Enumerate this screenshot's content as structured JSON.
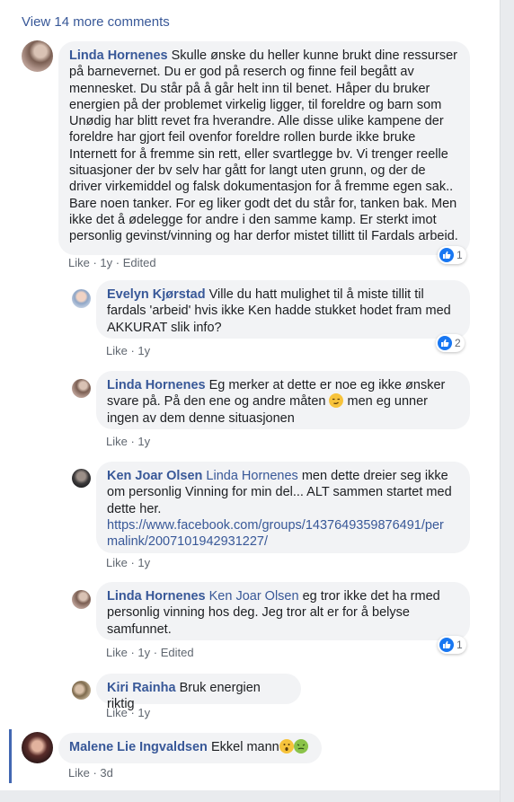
{
  "view_more": "View 14 more comments",
  "comments": [
    {
      "author": "Linda Hornenes",
      "text": "Skulle ønske du heller kunne brukt dine ressurser på barnevernet. Du er god på reserch og finne feil begått av mennesket. Du står på å går helt inn til benet. Håper du bruker energien på der problemet virkelig ligger, til foreldre og barn som Unødig har blitt revet fra hverandre. Alle disse ulike kampene der foreldre har gjort feil ovenfor foreldre rollen burde ikke bruke Internett for å fremme sin rett, eller svartlegge bv. Vi trenger reelle situasjoner der bv selv har gått for langt uten grunn, og der de driver virkemiddel og falsk dokumentasjon for å fremme egen sak.. Bare noen tanker. For eg liker godt det du står for, tanken bak. Men ikke det å ødelegge for andre i den samme kamp. Er sterkt imot personlig gevinst/vinning og har derfor mistet tillitt til Fardals arbeid.",
      "like": "Like",
      "time": "1y",
      "edited": "Edited",
      "reactions": "1"
    },
    {
      "author": "Evelyn Kjørstad",
      "text": "Ville du hatt mulighet til å miste tillit til fardals 'arbeid' hvis ikke Ken hadde stukket hodet fram med AKKURAT slik info?",
      "like": "Like",
      "time": "1y",
      "reactions": "2"
    },
    {
      "author": "Linda Hornenes",
      "text_a": "Eg merker at dette er noe eg ikke ønsker svare på. På den ene og andre måten",
      "text_b": "men eg unner ingen av dem denne situasjonen",
      "like": "Like",
      "time": "1y"
    },
    {
      "author": "Ken Joar Olsen",
      "tag": "Linda Hornenes",
      "text": "men dette dreier seg ikke om personlig Vinning for min del... ALT sammen startet med dette her.",
      "link_1": "https://www.facebook.com/groups/1437649359876491/per",
      "link_2": "malink/2007101942931227/",
      "like": "Like",
      "time": "1y"
    },
    {
      "author": "Linda Hornenes",
      "tag": "Ken Joar Olsen",
      "text": "eg tror ikke det ha rmed personlig vinning hos deg. Jeg tror alt er for å belyse samfunnet.",
      "like": "Like",
      "time": "1y",
      "edited": "Edited",
      "reactions": "1"
    },
    {
      "author": "Kiri Rainha",
      "text": "Bruk energien riktig",
      "like": "Like",
      "time": "1y"
    },
    {
      "author": "Malene Lie Ingvaldsen",
      "text": "Ekkel mann",
      "like": "Like",
      "time": "3d"
    }
  ],
  "colors": {
    "link": "#385898",
    "bubble": "#f2f3f5",
    "reaction": "#1877f2",
    "highlight": "#4267b2"
  }
}
